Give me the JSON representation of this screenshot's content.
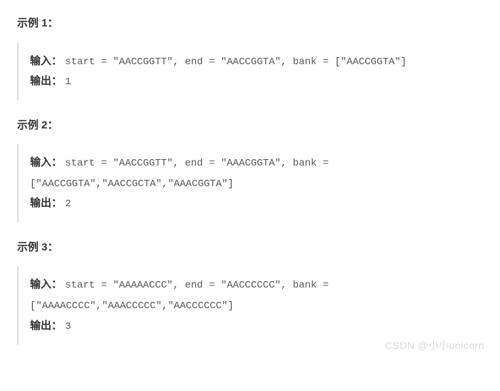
{
  "examples": [
    {
      "heading": "示例 1：",
      "input_label": "输入：",
      "input_code": "start = \"AACCGGTT\", end = \"AACCGGTA\", bank = [\"AACCGGTA\"]",
      "output_label": "输出：",
      "output_value": "1"
    },
    {
      "heading": "示例 2：",
      "input_label": "输入：",
      "input_code": "start = \"AACCGGTT\", end = \"AAACGGTA\", bank = [\"AACCGGTA\",\"AACCGCTA\",\"AAACGGTA\"]",
      "output_label": "输出：",
      "output_value": "2"
    },
    {
      "heading": "示例 3：",
      "input_label": "输入：",
      "input_code": "start = \"AAAAACCC\", end = \"AACCCCCC\", bank = [\"AAAACCCC\",\"AAACCCCC\",\"AACCCCCC\"]",
      "output_label": "输出：",
      "output_value": "3"
    }
  ],
  "watermark": "CSDN @小小unicorn"
}
